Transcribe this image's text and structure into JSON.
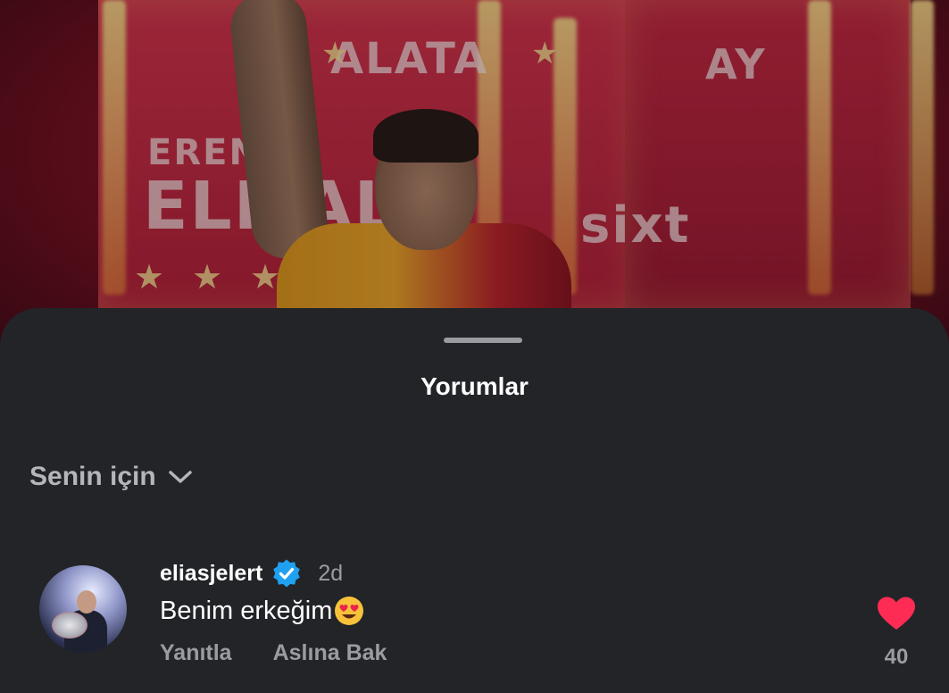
{
  "background": {
    "signage": {
      "top_banner": "ALATA",
      "name_small": "EREN",
      "name_large": "ELMALI",
      "sponsor": "sixt",
      "side": "AY"
    }
  },
  "sheet": {
    "title": "Yorumlar",
    "filter_label": "Senin için",
    "filter_icon": "chevron-down-icon"
  },
  "comments": [
    {
      "username": "eliasjelert",
      "verified": true,
      "time": "2d",
      "text": "Benim erkeğim",
      "emoji": "heart-eyes-emoji",
      "reply_label": "Yanıtla",
      "see_original_label": "Aslına Bak",
      "likes": "40",
      "liked": true,
      "like_color": "#fe2c55"
    }
  ],
  "colors": {
    "sheet_bg": "#222428",
    "verified_badge": "#20a0f0",
    "secondary_text": "#9a9ca0"
  }
}
